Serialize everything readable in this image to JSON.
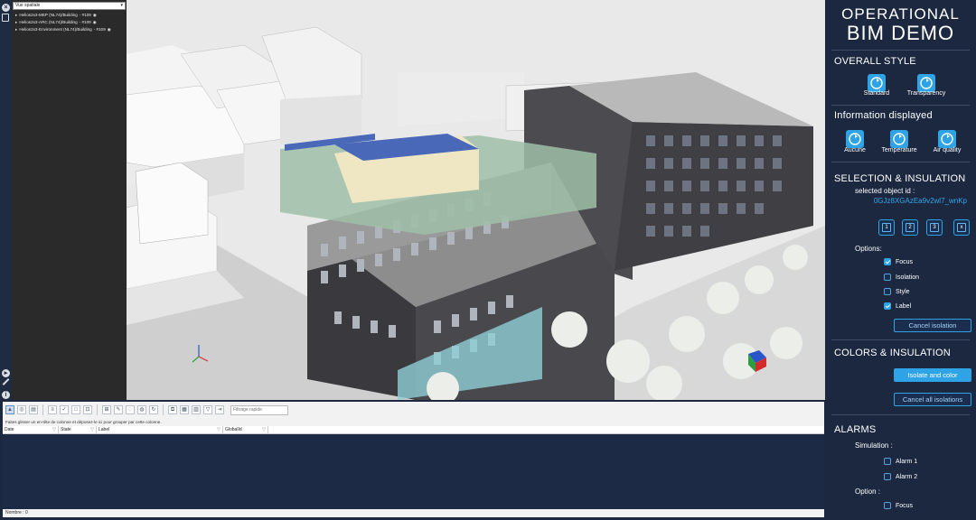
{
  "tree": {
    "dropdown": "Vue spatiale",
    "items": [
      {
        "label": "Helios2x3-MEP (NL74)/Building",
        "count": "- #109"
      },
      {
        "label": "Helios2x3-ARC (NL74)/Building",
        "count": "- #109"
      },
      {
        "label": "Helios2x3-Environment (NL74)/Building",
        "count": "- #109"
      }
    ]
  },
  "toolbar": {
    "filter_placeholder": "Filtrage rapide"
  },
  "grid": {
    "hint": "Faites glisser un en-tête de colonne et déposez-le ici pour grouper par cette colonne.",
    "columns": [
      "Date",
      "State",
      "Label",
      "GlobalId"
    ],
    "status": "Nombre : 0"
  },
  "panel": {
    "title_line1": "OPERATIONAL",
    "title_line2": "BIM DEMO",
    "overall_style": {
      "heading": "OVERALL STYLE",
      "buttons": [
        {
          "label": "Standard"
        },
        {
          "label": "Transparency"
        }
      ]
    },
    "info": {
      "heading": "Information displayed",
      "buttons": [
        {
          "label": "Aucune"
        },
        {
          "label": "Temperature"
        },
        {
          "label": "Air quality"
        }
      ]
    },
    "selection": {
      "heading": "SELECTION & INSULATION",
      "selected_label": "selected object id :",
      "selected_id": "0GJz8XGAzEa9v2wl7_wnKp",
      "square_buttons": [
        "1",
        "2",
        "3",
        "x"
      ],
      "options_label": "Options:",
      "options": [
        {
          "label": "Focus",
          "checked": true
        },
        {
          "label": "Isolation",
          "checked": false
        },
        {
          "label": "Style",
          "checked": false
        },
        {
          "label": "Label",
          "checked": true
        }
      ],
      "cancel_label": "Cancel isolation"
    },
    "colors": {
      "heading": "COLORS & INSULATION",
      "isolate_label": "Isolate and color",
      "cancel_all_label": "Cancel all isolations"
    },
    "alarms": {
      "heading": "ALARMS",
      "simulation_label": "Simulation :",
      "items": [
        {
          "label": "Alarm 1"
        },
        {
          "label": "Alarm 2"
        }
      ],
      "option_label": "Option :",
      "option_items": [
        {
          "label": "Focus"
        }
      ]
    }
  },
  "colors": {
    "accent": "#2ea3e6",
    "panel_bg": "#1b2840",
    "id_text": "#35a6ea"
  }
}
